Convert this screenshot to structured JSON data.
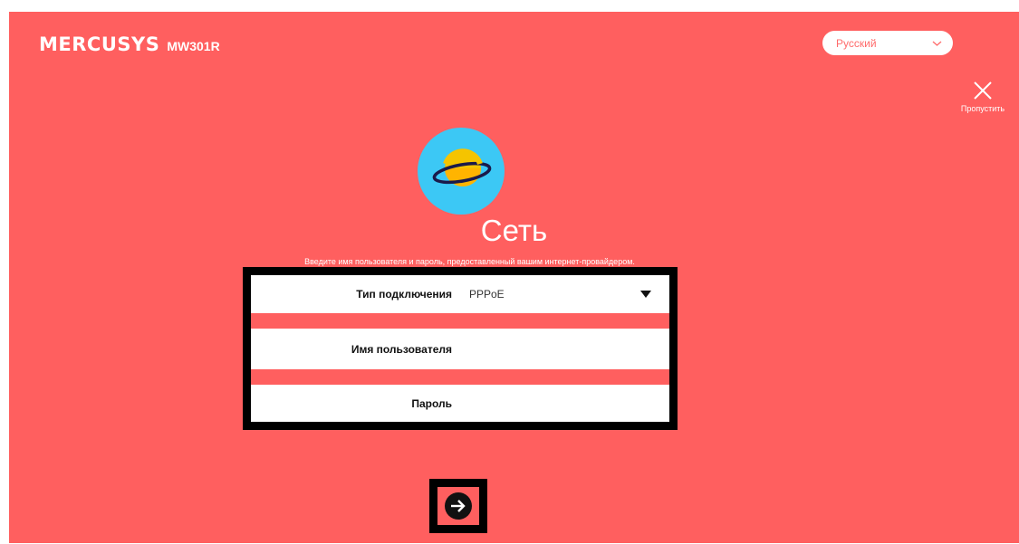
{
  "header": {
    "brand": "MERCUSYS",
    "model": "MW301R"
  },
  "language": {
    "selected": "Русский",
    "icon": "chevron-down-icon"
  },
  "skip": {
    "label": "Пропустить",
    "icon": "close-icon"
  },
  "main": {
    "icon": "planet-icon",
    "title": "Сеть",
    "subtitle": "Введите имя пользователя и пароль, предоставленный вашим интернет-провайдером."
  },
  "form": {
    "connection_type_label": "Тип подключения",
    "connection_type_value": "PPPoE",
    "username_label": "Имя пользователя",
    "username_value": "",
    "password_label": "Пароль",
    "password_value": ""
  },
  "next": {
    "icon": "arrow-right-icon"
  },
  "colors": {
    "background": "#ff5f5f",
    "text": "#ffffff",
    "highlight_frame": "#000000",
    "globe": "#3cc8f5",
    "planet": "#f5c400"
  }
}
